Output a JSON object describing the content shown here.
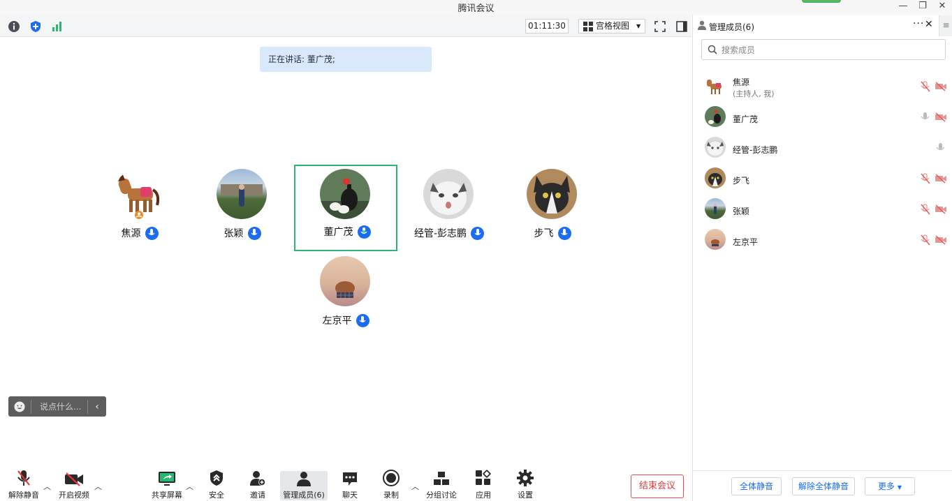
{
  "window": {
    "title": "腾讯会议"
  },
  "topbar": {
    "timer": "01:11:30",
    "view_label": "宫格视图"
  },
  "speaking": {
    "text": "正在讲话: 董广茂;"
  },
  "tiles": [
    {
      "name": "焦源",
      "active": false
    },
    {
      "name": "张颖",
      "active": false
    },
    {
      "name": "董广茂",
      "active": true
    },
    {
      "name": "经管-彭志鹏",
      "active": false
    },
    {
      "name": "步飞",
      "active": false
    },
    {
      "name": "左京平",
      "active": false
    }
  ],
  "chat": {
    "placeholder": "说点什么..."
  },
  "toolbar": {
    "unmute": "解除静音",
    "video": "开启视频",
    "share": "共享屏幕",
    "security": "安全",
    "invite": "邀请",
    "members": "管理成员(6)",
    "chat": "聊天",
    "record": "录制",
    "breakout": "分组讨论",
    "apps": "应用",
    "settings": "设置",
    "end": "结束会议"
  },
  "panel": {
    "title": "管理成员(6)",
    "search_placeholder": "搜索成员",
    "members": [
      {
        "name": "焦源",
        "sub": "(主持人, 我)",
        "mic": "muted",
        "video": "off"
      },
      {
        "name": "董广茂",
        "sub": "",
        "mic": "on",
        "video": "off"
      },
      {
        "name": "经管-彭志鹏",
        "sub": "",
        "mic": "on",
        "video": "none"
      },
      {
        "name": "步飞",
        "sub": "",
        "mic": "muted",
        "video": "off"
      },
      {
        "name": "张颖",
        "sub": "",
        "mic": "muted",
        "video": "off"
      },
      {
        "name": "左京平",
        "sub": "",
        "mic": "muted",
        "video": "off"
      }
    ],
    "footer": {
      "mute_all": "全体静音",
      "unmute_all": "解除全体静音",
      "more": "更多"
    }
  },
  "colors": {
    "accent": "#1b6cf2",
    "active_border": "#2bb673",
    "danger": "#e04040",
    "speaking_bg": "#dae8fb"
  }
}
